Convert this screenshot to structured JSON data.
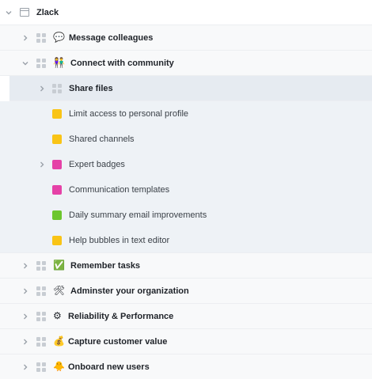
{
  "tree": {
    "root": {
      "label": "Zlack",
      "expanded": true,
      "icon": "window-icon"
    },
    "groups": [
      {
        "label": "Message colleagues",
        "emoji": "💬",
        "icon": "speech-bubble-icon",
        "expanded": false
      },
      {
        "label": "Connect with community",
        "emoji": "👫",
        "icon": "people-icon",
        "expanded": true
      },
      {
        "label": "Remember tasks",
        "emoji": "✅",
        "icon": "check-mark-icon",
        "expanded": false
      },
      {
        "label": "Adminster your organization",
        "emoji": "🛠",
        "icon": "tools-icon",
        "expanded": false
      },
      {
        "label": "Reliability & Performance",
        "emoji": "⚙",
        "icon": "gear-icon",
        "expanded": false
      },
      {
        "label": "Capture customer value",
        "emoji": "💰",
        "icon": "money-bag-icon",
        "expanded": false
      },
      {
        "label": "Onboard new users",
        "emoji": "🐥",
        "icon": "chick-icon",
        "expanded": false
      }
    ],
    "share_files": {
      "label": "Share files",
      "expanded": false
    },
    "items": [
      {
        "label": "Limit access to personal profile",
        "color": "#f9c416",
        "expandable": false
      },
      {
        "label": "Shared channels",
        "color": "#f9c416",
        "expandable": false
      },
      {
        "label": "Expert badges",
        "color": "#e541a7",
        "expandable": true
      },
      {
        "label": "Communication templates",
        "color": "#e541a7",
        "expandable": false
      },
      {
        "label": "Daily summary email improvements",
        "color": "#6cc62d",
        "expandable": false
      },
      {
        "label": "Help bubbles in text editor",
        "color": "#f9c416",
        "expandable": false
      }
    ]
  }
}
